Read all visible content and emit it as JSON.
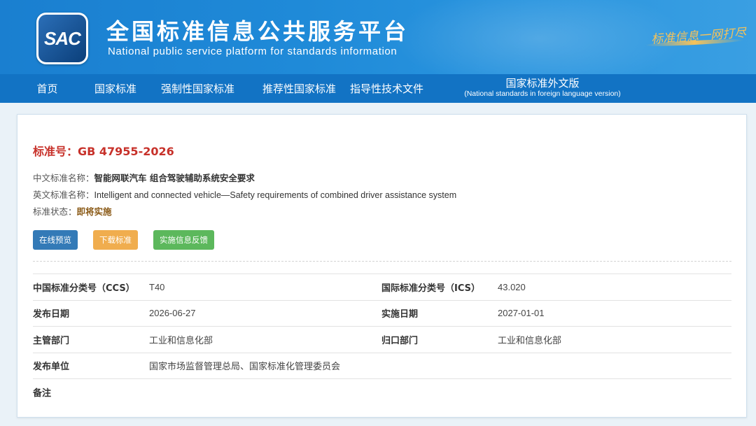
{
  "header": {
    "logo_text": "SAC",
    "title_cn": "全国标准信息公共服务平台",
    "title_en": "National public service platform  for standards information",
    "slogan": "标准信息一网打尽"
  },
  "nav": {
    "items": [
      {
        "label": "首页"
      },
      {
        "label": "国家标准"
      },
      {
        "label": "强制性国家标准"
      },
      {
        "label": "推荐性国家标准"
      },
      {
        "label": "指导性技术文件"
      }
    ],
    "foreign": {
      "label": "国家标准外文版",
      "sublabel": "(National standards in foreign language version)"
    }
  },
  "standard": {
    "number_label": "标准号：GB 47955-2026",
    "cn_name_label": "中文标准名称：",
    "cn_name": "智能网联汽车 组合驾驶辅助系统安全要求",
    "en_name_label": "英文标准名称：",
    "en_name": "Intelligent and connected vehicle—Safety requirements of combined driver assistance system",
    "status_label": "标准状态：",
    "status": "即将实施"
  },
  "buttons": {
    "preview": "在线预览",
    "download": "下载标准",
    "feedback": "实施信息反馈"
  },
  "details": {
    "ccs_label": "中国标准分类号（CCS）",
    "ccs": "T40",
    "ics_label": "国际标准分类号（ICS）",
    "ics": "43.020",
    "publish_date_label": "发布日期",
    "publish_date": "2026-06-27",
    "implement_date_label": "实施日期",
    "implement_date": "2027-01-01",
    "authority_label": "主管部门",
    "authority": "工业和信息化部",
    "responsible_label": "归口部门",
    "responsible": "工业和信息化部",
    "publisher_label": "发布单位",
    "publisher": "国家市场监督管理总局、国家标准化管理委员会",
    "remark_label": "备注",
    "remark": ""
  },
  "colors": {
    "banner": "#1f8ad8",
    "nav": "#1273c4",
    "std_number": "#c7312a",
    "preview_button": "#337ab7",
    "download_button": "#f0ad4e",
    "feedback_button": "#5cb85c"
  }
}
